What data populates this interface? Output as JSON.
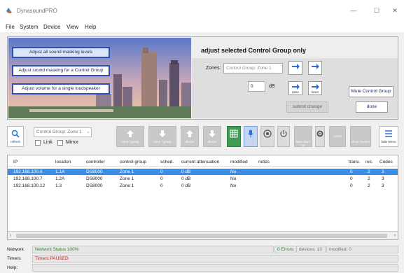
{
  "window": {
    "title": "DynasoundPRO",
    "minimize": "—",
    "maximize": "☐",
    "close": "✕"
  },
  "menu": [
    "File",
    "System",
    "Device",
    "View",
    "Help"
  ],
  "actions": [
    "Adjust all sound masking levels",
    "Adjust sound masking for a Control Group",
    "Adjust volume for a single loudspeaker"
  ],
  "panel": {
    "title": "adjust selected Control Group only",
    "zones_label": "Zones:",
    "zones_value": "Control Group: Zone 1",
    "db_value": "0",
    "db_unit": "dB",
    "raise": "raise",
    "lower": "lower",
    "mute_button": "Mute Control Group",
    "submit_button": "submit change",
    "done_button": "done"
  },
  "toolbar": {
    "refresh": "refresh",
    "group_select": "Control Group: Zone 1",
    "link": "Link",
    "mirror": "Mirror",
    "zone_group_1": "zone / group",
    "zone_group_2": "zone / group",
    "device_1": "device",
    "device_2": "device",
    "save_startup": "save start-up",
    "lock": "LOCK",
    "show_monitor": "show monitor",
    "hide_menu": "hide menu"
  },
  "table": {
    "columns": [
      "IP",
      "location",
      "controller",
      "control group",
      "sched.",
      "current attenuation",
      "modified",
      "notes",
      "trans.",
      "rec.",
      "Codes"
    ],
    "rows": [
      [
        "192.168.100.6",
        "1.1A",
        "DS8000",
        "Zone 1",
        "0",
        "0 dB",
        "No",
        "",
        "0",
        "2",
        "3"
      ],
      [
        "192.168.100.7",
        "1.2A",
        "DS8000",
        "Zone 1",
        "0",
        "0 dB",
        "No",
        "",
        "0",
        "2",
        "3"
      ],
      [
        "192.168.100.12",
        "1.3",
        "DS8000",
        "Zone 1",
        "0",
        "0 dB",
        "No",
        "",
        "0",
        "2",
        "3"
      ]
    ]
  },
  "status": {
    "network_label": "Network",
    "network_value": "Network Status 100%",
    "errors": "0 Errors",
    "devices": "devices: 13",
    "modified": "modified: 0",
    "timers_label": "Timers",
    "timers_value": "Timers PAUSED",
    "help_label": "Help:"
  },
  "colors": {
    "accent": "#2b4fb8",
    "selection": "#3b8ee6",
    "network_ok": "#2e8b2e",
    "timers_paused": "#d02020",
    "toolbar_green": "#3f9c53"
  }
}
